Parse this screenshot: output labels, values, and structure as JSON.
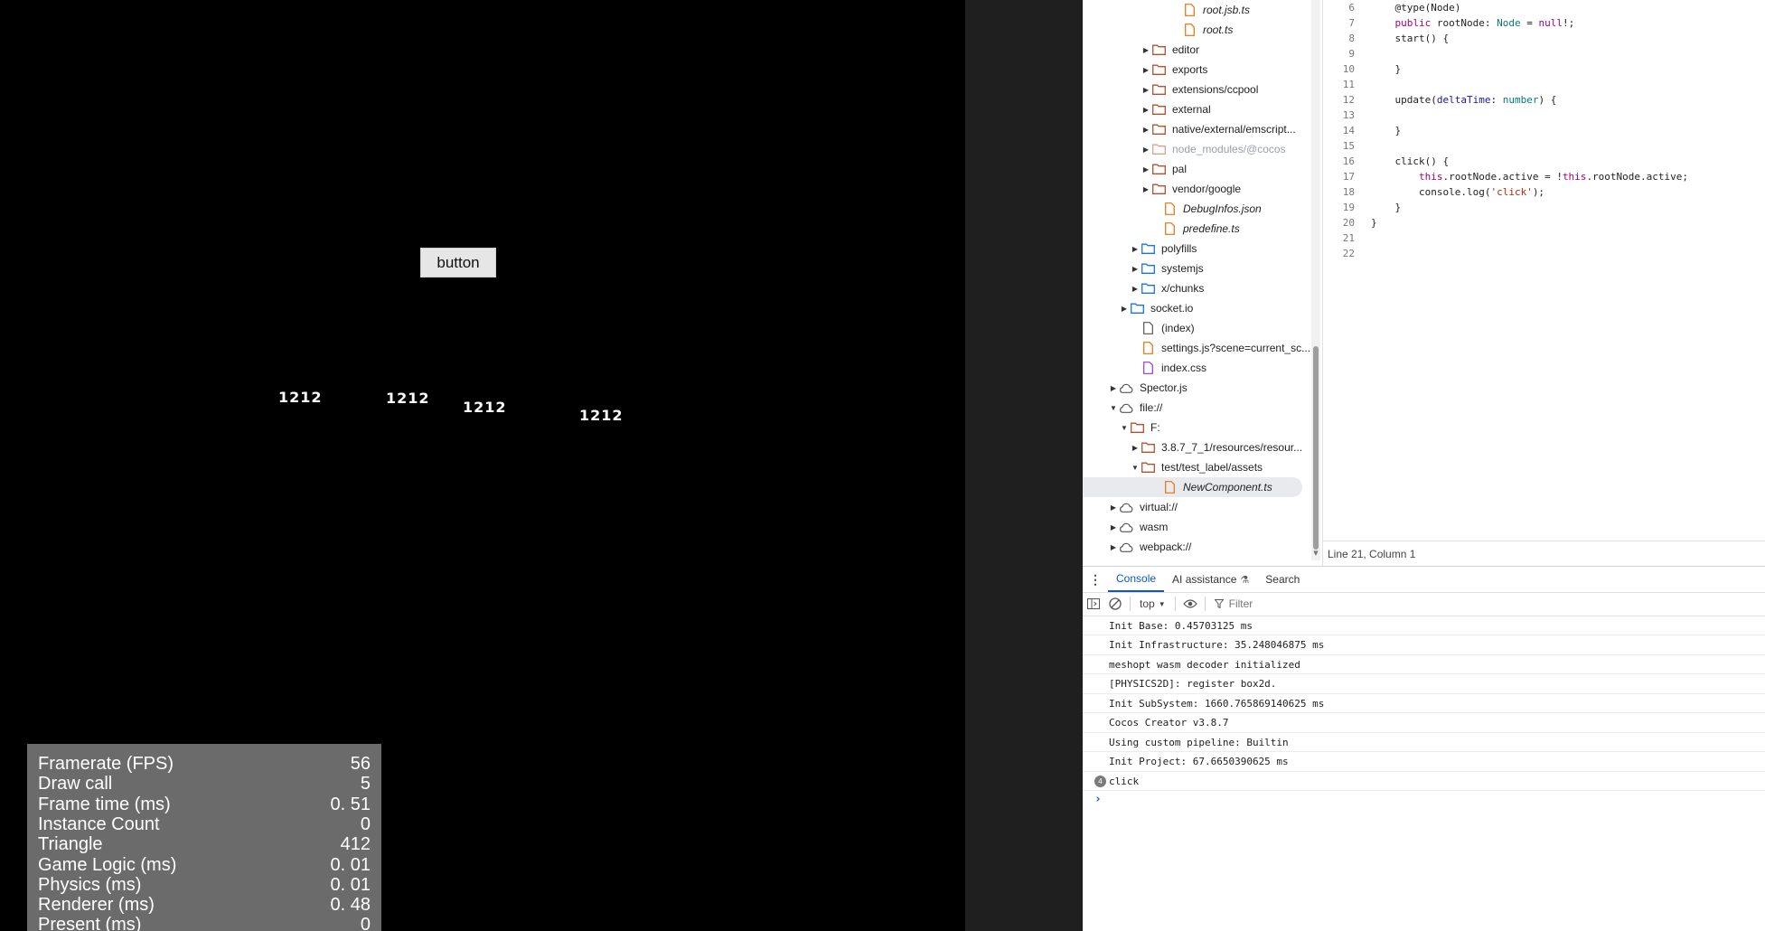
{
  "game": {
    "button_label": "button",
    "labels": [
      "1212",
      "1212",
      "1212",
      "1212"
    ],
    "stats": [
      {
        "name": "Framerate (FPS)",
        "value": "56"
      },
      {
        "name": "Draw call",
        "value": "5"
      },
      {
        "name": "Frame time (ms)",
        "value": "0. 51"
      },
      {
        "name": "Instance Count",
        "value": "0"
      },
      {
        "name": "Triangle",
        "value": "412"
      },
      {
        "name": "Game Logic (ms)",
        "value": "0. 01"
      },
      {
        "name": "Physics (ms)",
        "value": "0. 01"
      },
      {
        "name": "Renderer (ms)",
        "value": "0. 48"
      },
      {
        "name": "Present (ms)",
        "value": "0"
      }
    ]
  },
  "sources": {
    "tree": [
      {
        "label": "root.jsb.ts",
        "kind": "file-ts",
        "italic": true
      },
      {
        "label": "root.ts",
        "kind": "file-ts",
        "italic": true
      },
      {
        "label": "editor",
        "kind": "folder",
        "arrow": "right"
      },
      {
        "label": "exports",
        "kind": "folder",
        "arrow": "right"
      },
      {
        "label": "extensions/ccpool",
        "kind": "folder",
        "arrow": "right"
      },
      {
        "label": "external",
        "kind": "folder",
        "arrow": "right"
      },
      {
        "label": "native/external/emscript...",
        "kind": "folder",
        "arrow": "right"
      },
      {
        "label": "node_modules/@cocos",
        "kind": "folder-muted",
        "arrow": "right",
        "muted": true
      },
      {
        "label": "pal",
        "kind": "folder",
        "arrow": "right"
      },
      {
        "label": "vendor/google",
        "kind": "folder",
        "arrow": "right"
      },
      {
        "label": "DebugInfos.json",
        "kind": "file-ts",
        "italic": true
      },
      {
        "label": "predefine.ts",
        "kind": "file-ts",
        "italic": true
      },
      {
        "label": "polyfills",
        "kind": "folder-blue",
        "arrow": "right"
      },
      {
        "label": "systemjs",
        "kind": "folder-blue",
        "arrow": "right"
      },
      {
        "label": "x/chunks",
        "kind": "folder-blue",
        "arrow": "right"
      },
      {
        "label": "socket.io",
        "kind": "folder-blue",
        "arrow": "right"
      },
      {
        "label": "(index)",
        "kind": "file-plain"
      },
      {
        "label": "settings.js?scene=current_sc...",
        "kind": "file-ts"
      },
      {
        "label": "index.css",
        "kind": "file-css"
      },
      {
        "label": "Spector.js",
        "kind": "cloud",
        "arrow": "right"
      },
      {
        "label": "file://",
        "kind": "cloud",
        "arrow": "down"
      },
      {
        "label": "F:",
        "kind": "folder",
        "arrow": "down"
      },
      {
        "label": "3.8.7_7_1/resources/resour...",
        "kind": "folder",
        "arrow": "right"
      },
      {
        "label": "test/test_label/assets",
        "kind": "folder",
        "arrow": "down"
      },
      {
        "label": "NewComponent.ts",
        "kind": "file-ts",
        "italic": true,
        "selected": true
      },
      {
        "label": "virtual://",
        "kind": "cloud",
        "arrow": "right"
      },
      {
        "label": "wasm",
        "kind": "cloud",
        "arrow": "right"
      },
      {
        "label": "webpack://",
        "kind": "cloud",
        "arrow": "right"
      }
    ],
    "status": "Line 21, Column 1",
    "code": [
      {
        "n": "6",
        "t": "    @type(Node)"
      },
      {
        "n": "7",
        "t": "    public rootNode: Node = null!;"
      },
      {
        "n": "8",
        "t": "    start() {"
      },
      {
        "n": "9",
        "t": ""
      },
      {
        "n": "10",
        "t": "    }"
      },
      {
        "n": "11",
        "t": ""
      },
      {
        "n": "12",
        "t": "    update(deltaTime: number) {"
      },
      {
        "n": "13",
        "t": ""
      },
      {
        "n": "14",
        "t": "    }"
      },
      {
        "n": "15",
        "t": ""
      },
      {
        "n": "16",
        "t": "    click() {"
      },
      {
        "n": "17",
        "t": "        this.rootNode.active = !this.rootNode.active;"
      },
      {
        "n": "18",
        "t": "        console.log('click');"
      },
      {
        "n": "19",
        "t": "    }"
      },
      {
        "n": "20",
        "t": "}"
      },
      {
        "n": "21",
        "t": ""
      },
      {
        "n": "22",
        "t": ""
      }
    ]
  },
  "drawer": {
    "tabs": [
      "Console",
      "AI assistance",
      "Search"
    ],
    "active_tab": "Console",
    "context": "top",
    "filter_placeholder": "Filter",
    "messages": [
      "Init Base: 0.45703125 ms",
      "Init Infrastructure: 35.248046875 ms",
      "meshopt wasm decoder initialized",
      "[PHYSICS2D]: register box2d.",
      "Init SubSystem: 1660.765869140625 ms",
      "Cocos Creator v3.8.7",
      "Using custom pipeline: Builtin",
      "Init Project: 67.6650390625 ms"
    ],
    "grouped": {
      "count": "4",
      "text": "click"
    }
  },
  "colors": {
    "accent": "#0b57d0",
    "folder": "#b5522b",
    "folder_blue": "#1a73e8",
    "file_ts": "#e8710a",
    "file_css": "#9334e6"
  }
}
